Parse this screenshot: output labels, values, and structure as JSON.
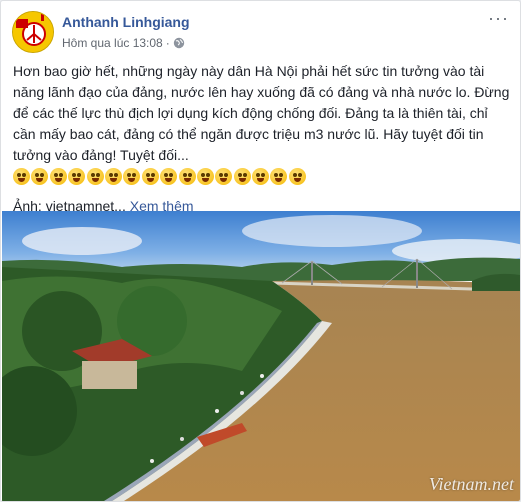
{
  "post": {
    "author": "Anthanh Linhgiang",
    "timestamp": "Hôm qua lúc 13:08",
    "separator": "·",
    "privacy_icon": "globe-icon",
    "more_icon": "more-options-icon",
    "more_glyph": "···",
    "text": "Hơn bao giờ hết, những ngày này dân Hà Nội phải hết sức tin tưởng vào tài năng lãnh đạo của đảng, nước lên hay xuống đã có đảng và nhà nước lo. Đừng để các thế lực thù địch lợi dụng kích động chống đối. Đảng ta là thiên tài, chỉ cần mấy bao cát, đảng có thể ngăn được triệu m3 nước lũ. Hãy tuyệt đối tin tưởng vào đảng! Tuyệt đối...",
    "emoji_count": 16,
    "photo_credit": "Ảnh: vietnamnet...",
    "see_more": "Xem thêm",
    "photo_watermark": "Vietnam.net",
    "photo_description_icon": "flood-river-photo"
  },
  "colors": {
    "link": "#365899",
    "text": "#1d2129",
    "meta": "#616770",
    "avatar_bg": "#f6c700",
    "river": "#b3884a"
  }
}
